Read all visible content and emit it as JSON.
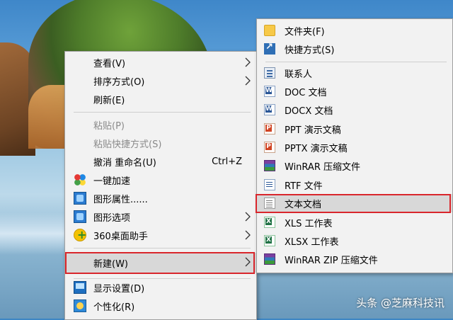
{
  "context_menu": {
    "items": [
      {
        "label": "查看(V)"
      },
      {
        "label": "排序方式(O)"
      },
      {
        "label": "刷新(E)"
      },
      {
        "label": "粘贴(P)"
      },
      {
        "label": "粘贴快捷方式(S)"
      },
      {
        "label": "撤消 重命名(U)",
        "shortcut": "Ctrl+Z"
      },
      {
        "label": "一键加速"
      },
      {
        "label": "图形属性......"
      },
      {
        "label": "图形选项"
      },
      {
        "label": "360桌面助手"
      },
      {
        "label": "新建(W)"
      },
      {
        "label": "显示设置(D)"
      },
      {
        "label": "个性化(R)"
      }
    ]
  },
  "new_submenu": {
    "items": [
      {
        "label": "文件夹(F)"
      },
      {
        "label": "快捷方式(S)"
      },
      {
        "label": "联系人"
      },
      {
        "label": "DOC 文档"
      },
      {
        "label": "DOCX 文档"
      },
      {
        "label": "PPT 演示文稿"
      },
      {
        "label": "PPTX 演示文稿"
      },
      {
        "label": "WinRAR 压缩文件"
      },
      {
        "label": "RTF 文件"
      },
      {
        "label": "文本文档"
      },
      {
        "label": "XLS 工作表"
      },
      {
        "label": "XLSX 工作表"
      },
      {
        "label": "WinRAR ZIP 压缩文件"
      }
    ]
  },
  "watermark": "头条 @芝麻科技讯",
  "colors": {
    "highlight_border": "#d9262c",
    "menu_bg": "#f2f2f2"
  }
}
